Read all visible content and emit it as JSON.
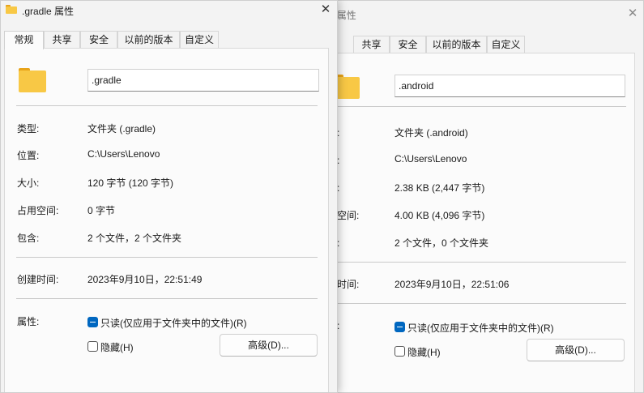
{
  "tabs": [
    "常规",
    "共享",
    "安全",
    "以前的版本",
    "自定义"
  ],
  "labels": {
    "type": "类型:",
    "location": "位置:",
    "size": "大小:",
    "size_on_disk": "占用空间:",
    "contains": "包含:",
    "created": "创建时间:",
    "attributes": "属性:"
  },
  "back_labels": {
    "type": "型:",
    "location": "置:",
    "size": "小:",
    "size_on_disk": "用空间:",
    "contains": "含:",
    "created": "建时间:",
    "attributes": "生:"
  },
  "front": {
    "title": ".gradle 属性",
    "name": ".gradle",
    "type": "文件夹 (.gradle)",
    "location": "C:\\Users\\Lenovo",
    "size": "120 字节 (120 字节)",
    "size_on_disk": "0 字节",
    "contains": "2 个文件，2 个文件夹",
    "created": "2023年9月10日，22:51:49",
    "readonly_label": "只读(仅应用于文件夹中的文件)(R)",
    "hidden_label": "隐藏(H)",
    "advanced_button": "高级(D)..."
  },
  "back": {
    "title": "ndroid 属性",
    "name": ".android",
    "type": "文件夹 (.android)",
    "location": "C:\\Users\\Lenovo",
    "size": "2.38 KB (2,447 字节)",
    "size_on_disk": "4.00 KB (4,096 字节)",
    "contains": "2 个文件，0 个文件夹",
    "created": "2023年9月10日，22:51:06",
    "readonly_label": "只读(仅应用于文件夹中的文件)(R)",
    "hidden_label": "隐藏(H)",
    "advanced_button": "高级(D)..."
  },
  "icons": {
    "close": "close-icon",
    "folder": "folder-icon"
  },
  "colors": {
    "accent": "#0067c0",
    "folder": "#f8c845",
    "folder_tab": "#e8a319"
  }
}
